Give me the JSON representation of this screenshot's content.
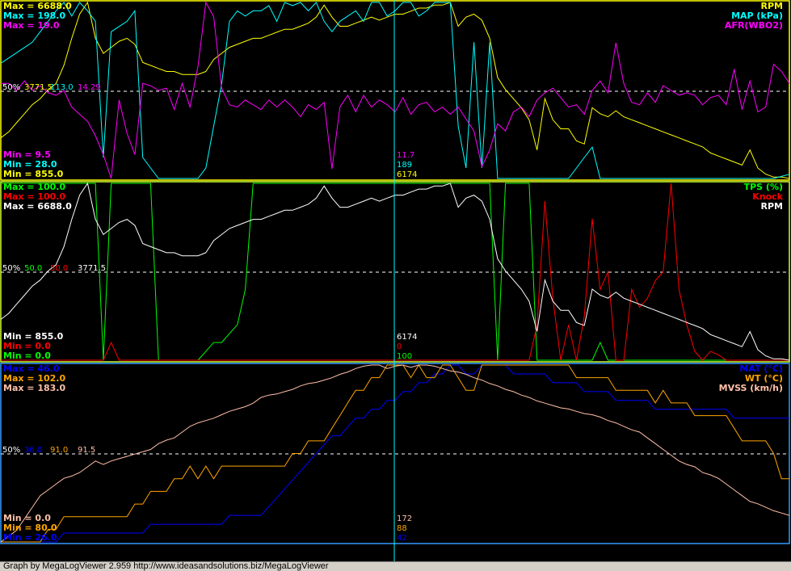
{
  "footer": {
    "text": "Graph by MegaLogViewer 2.959 http://www.ideasandsolutions.biz/MegaLogViewer"
  },
  "cursor": {
    "p1": [
      "11.7",
      "189",
      "6174"
    ],
    "p2": [
      "6174",
      "0",
      "100"
    ],
    "p3": [
      "172",
      "88",
      "42"
    ]
  },
  "chart_data": [
    {
      "type": "line",
      "panel": 1,
      "samples": 101,
      "grid": "dashed 50% line",
      "series": [
        {
          "name": "RPM",
          "color": "#ffff00",
          "max_label": "Max = 6688.0",
          "min_label": "Min = 855.0",
          "mid_label": "3771.5",
          "values": [
            2200,
            2400,
            2700,
            3000,
            3300,
            3500,
            3800,
            4000,
            4600,
            5500,
            6300,
            6688,
            5500,
            5000,
            5200,
            5400,
            5500,
            5300,
            4700,
            4600,
            4500,
            4400,
            4400,
            4300,
            4300,
            4300,
            4400,
            4800,
            5000,
            5200,
            5300,
            5400,
            5500,
            5500,
            5600,
            5700,
            5800,
            5800,
            5900,
            6000,
            6200,
            6600,
            6200,
            5900,
            5900,
            6000,
            6100,
            6200,
            6100,
            6200,
            6300,
            6300,
            6400,
            6500,
            6500,
            6600,
            6600,
            6688,
            5900,
            6200,
            6300,
            6100,
            5500,
            4200,
            3800,
            3500,
            3200,
            2800,
            1800,
            3500,
            2800,
            2500,
            2500,
            2100,
            2000,
            3200,
            3000,
            2900,
            3100,
            2900,
            2800,
            2700,
            2600,
            2500,
            2400,
            2300,
            2200,
            2100,
            2000,
            1900,
            1700,
            1600,
            1500,
            1400,
            1300,
            1800,
            1200,
            1000,
            900,
            900,
            855
          ]
        },
        {
          "name": "MAP (kPa)",
          "color": "#00ffff",
          "max_label": "Max = 198.0",
          "min_label": "Min = 28.0",
          "mid_label": "113.0",
          "values": [
            140,
            145,
            150,
            155,
            160,
            170,
            180,
            190,
            198,
            185,
            198,
            190,
            180,
            50,
            170,
            175,
            180,
            190,
            50,
            40,
            30,
            30,
            30,
            30,
            30,
            30,
            40,
            80,
            120,
            180,
            190,
            185,
            190,
            190,
            195,
            180,
            198,
            195,
            198,
            190,
            198,
            180,
            170,
            180,
            185,
            190,
            180,
            198,
            198,
            185,
            190,
            198,
            198,
            185,
            190,
            198,
            198,
            198,
            80,
            40,
            160,
            40,
            160,
            30,
            30,
            30,
            30,
            30,
            30,
            30,
            30,
            30,
            30,
            40,
            50,
            60,
            30,
            30,
            30,
            30,
            30,
            30,
            30,
            30,
            30,
            30,
            30,
            30,
            30,
            30,
            30,
            30,
            30,
            30,
            30,
            30,
            30,
            30,
            30,
            32,
            34
          ]
        },
        {
          "name": "AFR(WBO2)",
          "color": "#ff00ff",
          "max_label": "Max = 19.0",
          "min_label": "Min = 9.5",
          "mid_label": "14.29",
          "values": [
            13.5,
            13.5,
            13.2,
            13.6,
            13.2,
            13.4,
            13.1,
            13.0,
            13.2,
            12.5,
            12.2,
            11.9,
            11.3,
            10.5,
            9.5,
            12.8,
            11.4,
            10.5,
            13.5,
            13.4,
            13.2,
            13.3,
            12.4,
            13.5,
            12.5,
            14.2,
            16.9,
            16.3,
            13.3,
            12.6,
            12.5,
            12.8,
            12.6,
            12.4,
            12.8,
            12.5,
            12.8,
            12.5,
            12.1,
            12.6,
            12.4,
            12.7,
            9.9,
            12.5,
            13.0,
            12.3,
            13.0,
            12.5,
            12.8,
            12.6,
            12.3,
            12.9,
            12.2,
            12.6,
            12.7,
            12.3,
            12.5,
            12.2,
            12.5,
            12.0,
            11.5,
            10.0,
            10.7,
            11.8,
            11.5,
            12.3,
            12.5,
            12.1,
            12.8,
            13.1,
            13.3,
            12.9,
            12.5,
            12.6,
            12.2,
            13.2,
            13.6,
            13.1,
            15.2,
            13.5,
            12.7,
            12.6,
            13.1,
            12.7,
            13.4,
            13.2,
            13.0,
            13.1,
            13.0,
            12.6,
            12.9,
            13.0,
            12.6,
            14.1,
            12.4,
            13.6,
            12.3,
            12.5,
            14.3,
            14.0,
            13.5
          ]
        }
      ]
    },
    {
      "type": "line",
      "panel": 2,
      "samples": 101,
      "grid": "dashed 50% line",
      "series": [
        {
          "name": "TPS (%)",
          "color": "#00ff00",
          "max_label": "Max = 100.0",
          "min_label": "Min = 0.0",
          "mid_label": "50.0",
          "values": [
            100,
            100,
            100,
            100,
            100,
            100,
            100,
            100,
            100,
            100,
            100,
            100,
            100,
            0,
            100,
            100,
            100,
            100,
            100,
            100,
            0,
            0,
            0,
            0,
            0,
            0,
            5,
            10,
            10,
            15,
            20,
            40,
            100,
            100,
            100,
            100,
            100,
            100,
            100,
            100,
            100,
            100,
            100,
            100,
            100,
            100,
            100,
            100,
            100,
            100,
            100,
            100,
            100,
            100,
            100,
            100,
            100,
            100,
            100,
            100,
            100,
            100,
            100,
            0,
            100,
            100,
            100,
            100,
            0,
            0,
            0,
            0,
            0,
            0,
            0,
            0,
            10,
            0,
            0,
            0,
            0,
            0,
            0,
            0,
            0,
            0,
            0,
            0,
            0,
            0,
            0,
            0,
            0,
            0,
            0,
            0,
            0,
            0,
            0,
            0,
            0
          ]
        },
        {
          "name": "Knock",
          "color": "#ff0000",
          "max_label": "Max = 100.0",
          "min_label": "Min = 0.0",
          "mid_label": "50.0",
          "values": [
            0,
            0,
            0,
            0,
            0,
            0,
            0,
            0,
            0,
            0,
            0,
            0,
            0,
            0,
            10,
            0,
            0,
            0,
            0,
            0,
            0,
            0,
            0,
            0,
            0,
            0,
            0,
            0,
            0,
            0,
            0,
            0,
            0,
            0,
            0,
            0,
            0,
            0,
            0,
            0,
            0,
            0,
            0,
            0,
            0,
            0,
            0,
            0,
            0,
            0,
            0,
            0,
            0,
            0,
            0,
            0,
            0,
            0,
            0,
            0,
            0,
            0,
            0,
            0,
            0,
            0,
            0,
            0,
            20,
            90,
            35,
            0,
            20,
            0,
            25,
            80,
            40,
            50,
            0,
            0,
            40,
            30,
            35,
            45,
            50,
            100,
            40,
            20,
            5,
            0,
            5,
            3,
            0,
            0,
            0,
            0,
            0,
            0,
            0,
            0,
            0
          ]
        },
        {
          "name": "RPM",
          "color": "#ffffff",
          "max_label": "Max = 6688.0",
          "min_label": "Min = 855.0",
          "mid_label": "3771.5",
          "values": [
            2200,
            2400,
            2700,
            3000,
            3300,
            3500,
            3800,
            4000,
            4600,
            5500,
            6300,
            6688,
            5500,
            5000,
            5200,
            5400,
            5500,
            5300,
            4700,
            4600,
            4500,
            4400,
            4400,
            4300,
            4300,
            4300,
            4400,
            4800,
            5000,
            5200,
            5300,
            5400,
            5500,
            5500,
            5600,
            5700,
            5800,
            5800,
            5900,
            6000,
            6200,
            6600,
            6200,
            5900,
            5900,
            6000,
            6100,
            6200,
            6100,
            6200,
            6300,
            6300,
            6400,
            6500,
            6500,
            6600,
            6600,
            6688,
            5900,
            6200,
            6300,
            6100,
            5500,
            4200,
            3800,
            3500,
            3200,
            2800,
            1800,
            3500,
            2800,
            2500,
            2500,
            2100,
            2000,
            3200,
            3000,
            2900,
            3100,
            2900,
            2800,
            2700,
            2600,
            2500,
            2400,
            2300,
            2200,
            2100,
            2000,
            1900,
            1700,
            1600,
            1500,
            1400,
            1300,
            1800,
            1200,
            1000,
            900,
            900,
            855
          ]
        }
      ]
    },
    {
      "type": "line",
      "panel": 3,
      "samples": 101,
      "grid": "dashed 50% line",
      "series": [
        {
          "name": "MAT (°C)",
          "color": "#0000ff",
          "max_label": "Max = 46.0",
          "min_label": "Min = 26.0",
          "mid_label": "36.0",
          "values": [
            26,
            26,
            26,
            26,
            26,
            26,
            26,
            26,
            27,
            27,
            27,
            27,
            27,
            27,
            27,
            27,
            27,
            27,
            27,
            28,
            28,
            28,
            28,
            28,
            28,
            28,
            28,
            28,
            28,
            29,
            29,
            29,
            29,
            29,
            30,
            31,
            32,
            33,
            34,
            35,
            36,
            37,
            38,
            38,
            39,
            40,
            40,
            41,
            41,
            42,
            42,
            43,
            43,
            44,
            44,
            45,
            45,
            46,
            46,
            45,
            45,
            46,
            46,
            46,
            46,
            45,
            45,
            45,
            45,
            45,
            44,
            44,
            44,
            44,
            43,
            43,
            43,
            43,
            42,
            42,
            42,
            42,
            42,
            41,
            41,
            41,
            41,
            41,
            41,
            41,
            41,
            41,
            41,
            40,
            40,
            40,
            40,
            40,
            40,
            40,
            40
          ]
        },
        {
          "name": "WT (°C)",
          "color": "#ffa500",
          "max_label": "Max = 102.0",
          "min_label": "Min = 80.0",
          "mid_label": "91.0",
          "values": [
            80,
            80,
            80,
            80,
            80,
            80,
            81,
            81,
            82,
            82,
            82,
            82,
            82,
            82,
            82,
            82,
            82,
            83,
            83,
            84,
            84,
            84,
            85,
            85,
            86,
            85,
            86,
            85,
            86,
            86,
            86,
            86,
            86,
            86,
            86,
            86,
            86,
            87,
            87,
            88,
            88,
            88,
            89,
            90,
            91,
            92,
            92,
            93,
            93,
            94,
            94,
            94,
            93,
            94,
            93,
            93,
            94,
            94,
            93,
            92,
            92,
            94,
            94,
            94,
            94,
            94,
            94,
            94,
            94,
            94,
            94,
            94,
            94,
            93,
            93,
            93,
            93,
            93,
            92,
            92,
            92,
            92,
            92,
            91,
            92,
            91,
            91,
            91,
            90,
            90,
            90,
            90,
            90,
            89,
            88,
            88,
            88,
            88,
            87,
            85,
            85
          ]
        },
        {
          "name": "MVSS (km/h)",
          "color": "#ffc0a8",
          "max_label": "Max = 183.0",
          "min_label": "Min = 0.0",
          "mid_label": "91.5",
          "values": [
            30,
            35,
            40,
            50,
            60,
            70,
            75,
            80,
            85,
            87,
            90,
            95,
            100,
            97,
            100,
            102,
            104,
            106,
            108,
            110,
            115,
            118,
            120,
            125,
            130,
            133,
            135,
            137,
            140,
            143,
            145,
            147,
            150,
            155,
            157,
            158,
            160,
            162,
            165,
            167,
            168,
            170,
            172,
            175,
            177,
            180,
            182,
            183,
            183,
            180,
            182,
            183,
            181,
            183,
            183,
            182,
            180,
            178,
            177,
            175,
            172,
            170,
            167,
            165,
            162,
            160,
            157,
            155,
            152,
            150,
            148,
            146,
            145,
            143,
            141,
            140,
            138,
            135,
            133,
            130,
            127,
            125,
            120,
            115,
            110,
            105,
            100,
            97,
            95,
            90,
            88,
            85,
            80,
            75,
            70,
            65,
            63,
            60,
            57,
            55,
            53
          ]
        }
      ]
    }
  ]
}
